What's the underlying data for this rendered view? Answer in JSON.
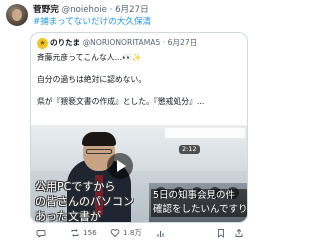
{
  "author": {
    "name": "菅野完",
    "handle": "@noiehoie",
    "date": "6月27日",
    "hashtag": "#捕まってないだけの大久保清"
  },
  "quoted": {
    "name": "のりたま",
    "handle": "@NORIONORITAMA5",
    "date": "6月27日",
    "lines": [
      "斉藤元彦ってこんな人...👀✨",
      "自分の過ちは絶対に認めない。",
      "県が『猥褻文書の作成』とした。『懲戒処分』..."
    ],
    "media": {
      "caption_lines": [
        "5日の知事会見の件",
        "確認をしたいんですり"
      ],
      "subtitles": [
        "公用PCですから",
        "の皆さんのパソコン",
        "あった文書が"
      ],
      "duration": "2:12"
    }
  },
  "actions": {
    "reply": "",
    "retweet": "156",
    "like": "1.8万",
    "views": "",
    "bookmark": "",
    "share": ""
  }
}
